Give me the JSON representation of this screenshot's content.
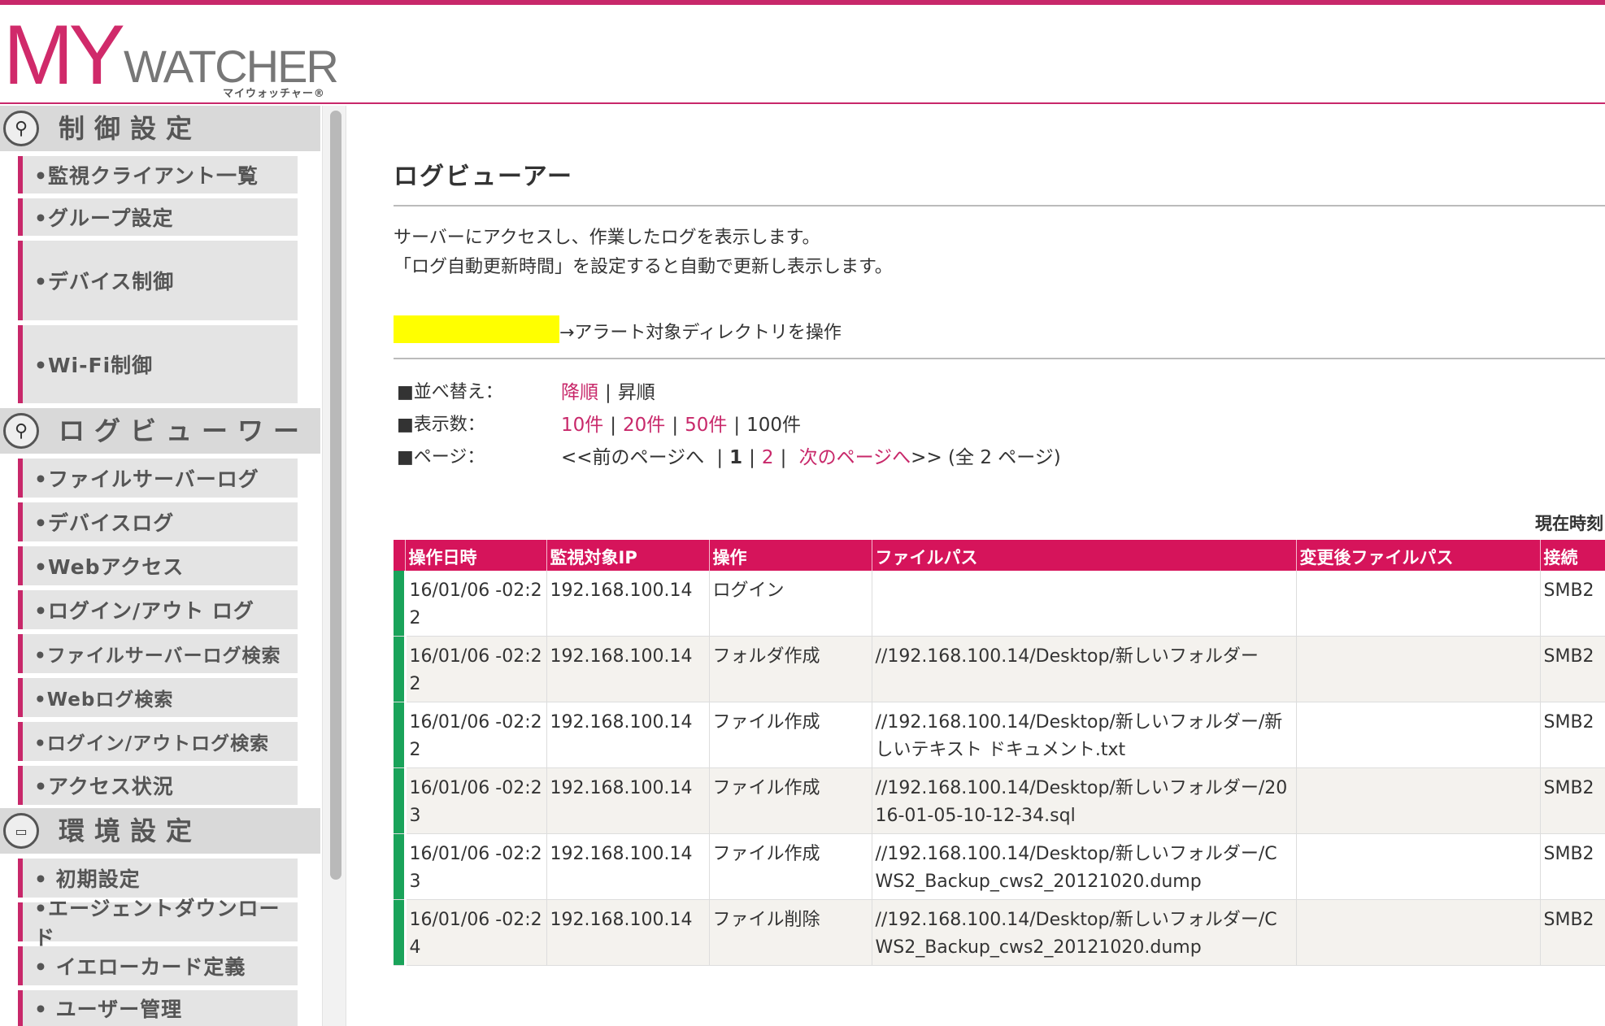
{
  "header": {
    "logo_my": "MY",
    "logo_watcher": "WATCHER",
    "logo_kana": "マイウォッチャー®"
  },
  "sidebar": {
    "sections": [
      {
        "label": "制御設定",
        "icon": "search-icon"
      },
      {
        "label": "ログビューワー",
        "icon": "magnify-icon"
      },
      {
        "label": "環境設定",
        "icon": "monitor-icon"
      }
    ],
    "items": [
      "•監視クライアント一覧",
      "•グループ設定",
      "•デバイス制御",
      "•Wi-Fi制御",
      "•ファイルサーバーログ",
      "•デバイスログ",
      "•Webアクセス",
      "•ログイン/アウト ログ",
      "•ファイルサーバーログ検索",
      "•Webログ検索",
      "•ログイン/アウトログ検索",
      "•アクセス状況",
      "• 初期設定",
      "•エージェントダウンロード",
      "• イエローカード定義",
      "• ユーザー管理"
    ]
  },
  "main": {
    "title": "ログビューアー",
    "desc1": "サーバーにアクセスし、作業したログを表示します。",
    "desc2": "「ログ自動更新時間」を設定すると自動で更新し表示します。",
    "legend_text": "→アラート対象ディレクトリを操作",
    "legend_color": "#ffff00",
    "sort": {
      "label": "■並べ替え：",
      "desc": "降順",
      "sep": "|",
      "asc": "昇順"
    },
    "count": {
      "label": "■表示数：",
      "o10": "10件",
      "o20": "20件",
      "o50": "50件",
      "o100": "100件"
    },
    "pager": {
      "label": "■ページ：",
      "prev": "<<前のページへ",
      "p1": "1",
      "p2": "2",
      "next": "次のページへ",
      "next_suffix": ">>",
      "total": "(全 2 ページ)"
    },
    "time_label": "現在時刻",
    "table": {
      "headers": [
        "操作日時",
        "監視対象IP",
        "操作",
        "ファイルパス",
        "変更後ファイルパス",
        "接続"
      ],
      "rows": [
        [
          "16/01/06 -02:22",
          "192.168.100.14",
          "ログイン",
          "",
          "",
          "SMB2"
        ],
        [
          "16/01/06 -02:22",
          "192.168.100.14",
          "フォルダ作成",
          "//192.168.100.14/Desktop/新しいフォルダー",
          "",
          "SMB2"
        ],
        [
          "16/01/06 -02:22",
          "192.168.100.14",
          "ファイル作成",
          "//192.168.100.14/Desktop/新しいフォルダー/新しいテキスト ドキュメント.txt",
          "",
          "SMB2"
        ],
        [
          "16/01/06 -02:23",
          "192.168.100.14",
          "ファイル作成",
          "//192.168.100.14/Desktop/新しいフォルダー/2016-01-05-10-12-34.sql",
          "",
          "SMB2"
        ],
        [
          "16/01/06 -02:23",
          "192.168.100.14",
          "ファイル作成",
          "//192.168.100.14/Desktop/新しいフォルダー/CWS2_Backup_cws2_20121020.dump",
          "",
          "SMB2"
        ],
        [
          "16/01/06 -02:24",
          "192.168.100.14",
          "ファイル削除",
          "//192.168.100.14/Desktop/新しいフォルダー/CWS2_Backup_cws2_20121020.dump",
          "",
          "SMB2"
        ]
      ]
    }
  }
}
